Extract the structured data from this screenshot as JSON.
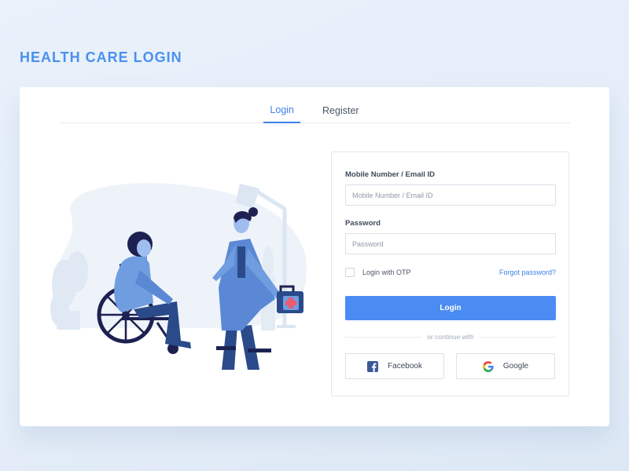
{
  "page": {
    "title": "HEALTH CARE LOGIN"
  },
  "tabs": [
    {
      "label": "Login",
      "active": true
    },
    {
      "label": "Register",
      "active": false
    }
  ],
  "form": {
    "username_label": "Mobile Number / Email ID",
    "username_placeholder": "Mobile Number / Email ID",
    "username_value": "",
    "password_label": "Password",
    "password_placeholder": "Password",
    "password_value": "",
    "otp_label": "Login with OTP",
    "otp_checked": false,
    "forgot_label": "Forgot password?",
    "login_button": "Login",
    "divider_text": "or continue with",
    "facebook_label": "Facebook",
    "google_label": "Google"
  },
  "icons": {
    "facebook": "facebook-icon",
    "google": "google-icon",
    "illustration": "healthcare-illustration"
  },
  "colors": {
    "accent": "#4a8cf2",
    "title": "#4a90f0",
    "facebook": "#3b5998"
  }
}
